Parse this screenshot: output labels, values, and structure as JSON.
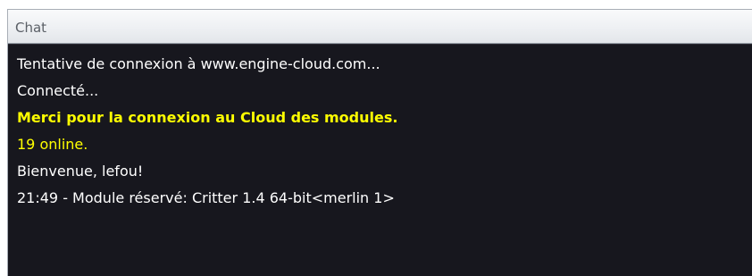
{
  "window": {
    "title": "Chat"
  },
  "colors": {
    "background": "#17171e",
    "text": "#ffffff",
    "highlight": "#ffff00"
  },
  "messages": [
    {
      "text": "Tentative de connexion à www.engine-cloud.com...",
      "style": "white"
    },
    {
      "text": "Connecté...",
      "style": "white"
    },
    {
      "text": "Merci pour la connexion au Cloud des modules.",
      "style": "bold-yellow"
    },
    {
      "text": "19 online.",
      "style": "yellow"
    },
    {
      "text": "Bienvenue, lefou!",
      "style": "white"
    },
    {
      "text": "21:49 - Module réservé: Critter 1.4 64-bit<merlin 1>",
      "style": "white"
    }
  ]
}
